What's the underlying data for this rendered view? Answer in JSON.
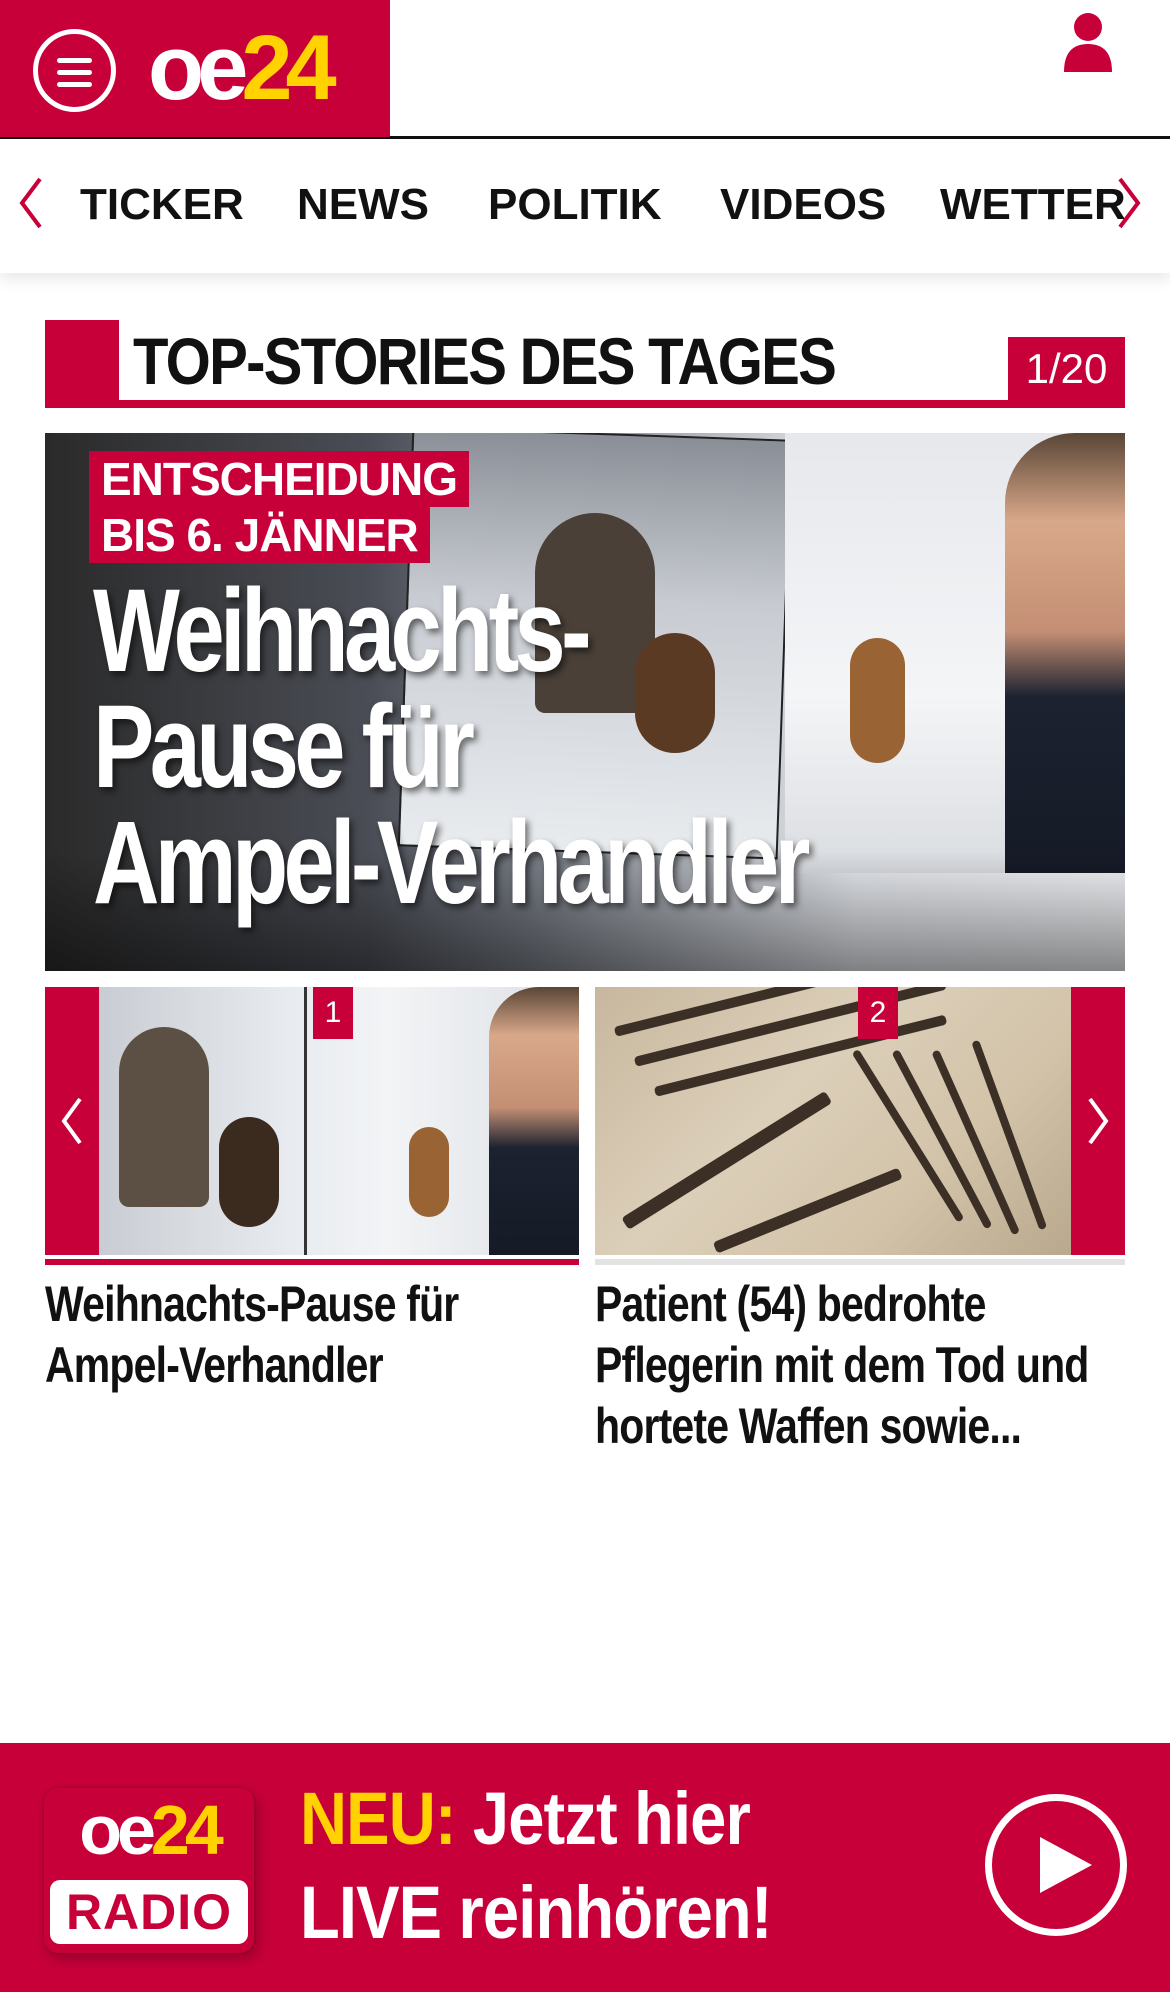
{
  "header": {
    "logo_oe": "oe",
    "logo_num": "24",
    "menu_icon": "hamburger-menu-icon",
    "user_icon": "user-icon"
  },
  "nav": {
    "items": [
      {
        "label": "TICKER"
      },
      {
        "label": "NEWS"
      },
      {
        "label": "POLITIK"
      },
      {
        "label": "VIDEOS"
      },
      {
        "label": "WETTER"
      }
    ]
  },
  "section": {
    "title": "TOP-STORIES DES TAGES",
    "counter": "1/20"
  },
  "hero": {
    "tag_line1": "ENTSCHEIDUNG",
    "tag_line2": "BIS 6. JÄNNER",
    "headline_lines": [
      "Weihnachts-",
      "Pause für",
      "Ampel-Verhandler"
    ]
  },
  "carousel": {
    "cards": [
      {
        "badge": "1",
        "title_lines": [
          "Weihnachts-Pause für",
          "Ampel-Verhandler"
        ]
      },
      {
        "badge": "2",
        "title_lines": [
          "Patient (54) bedrohte",
          "Pflegerin mit dem Tod und",
          "hortete Waffen sowie..."
        ]
      }
    ]
  },
  "radio": {
    "logo_oe": "oe",
    "logo_num": "24",
    "logo_radio": "RADIO",
    "neu": "NEU:",
    "line1_rest": " Jetzt hier",
    "line2": "LIVE reinhören!"
  },
  "colors": {
    "brand_red": "#c8003a",
    "brand_yellow": "#ffd200"
  }
}
